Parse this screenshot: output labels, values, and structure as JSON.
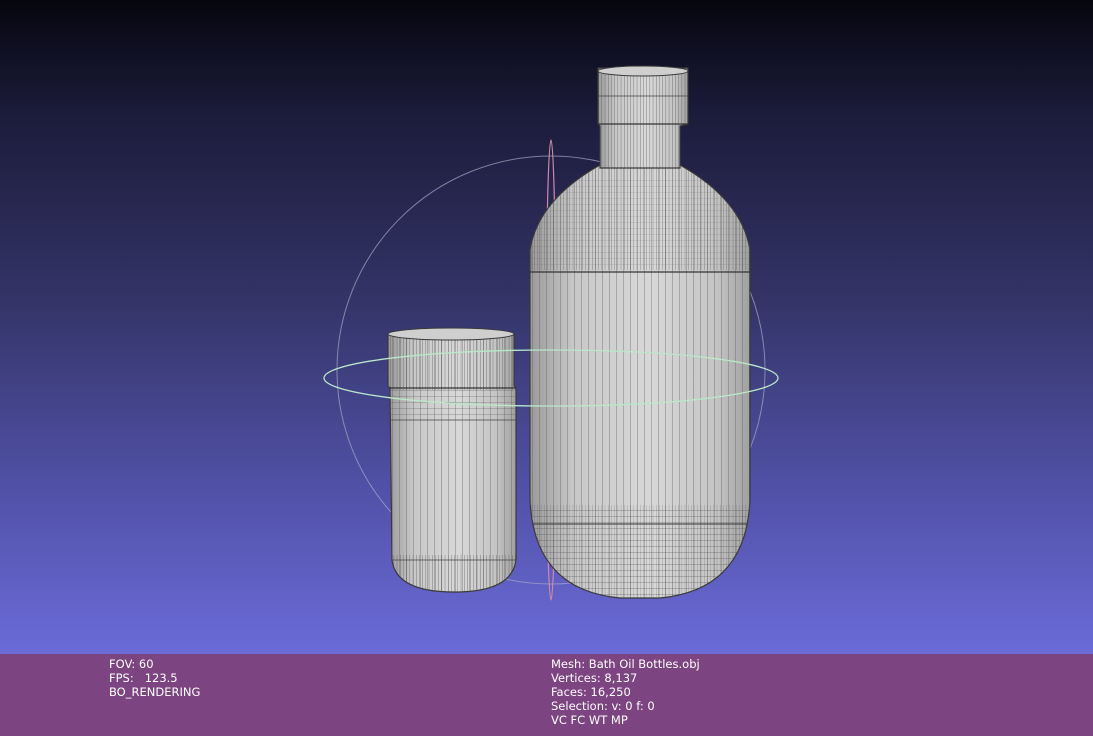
{
  "viewer": {
    "background_top": "#06060f",
    "background_bottom": "#6b6bd9",
    "infobar_color": "#7c4481"
  },
  "info_left": {
    "fov": "FOV: 60",
    "fps": "FPS:   123.5",
    "mode": "BO_RENDERING"
  },
  "info_right": {
    "mesh": "Mesh: Bath Oil Bottles.obj",
    "vertices": "Vertices: 8,137",
    "faces": "Faces: 16,250",
    "selection": "Selection: v: 0 f: 0",
    "flags": "VC FC WT MP"
  },
  "scene": {
    "trackball": "trackball-gizmo",
    "objects": [
      "small-jar",
      "tall-bottle"
    ]
  }
}
